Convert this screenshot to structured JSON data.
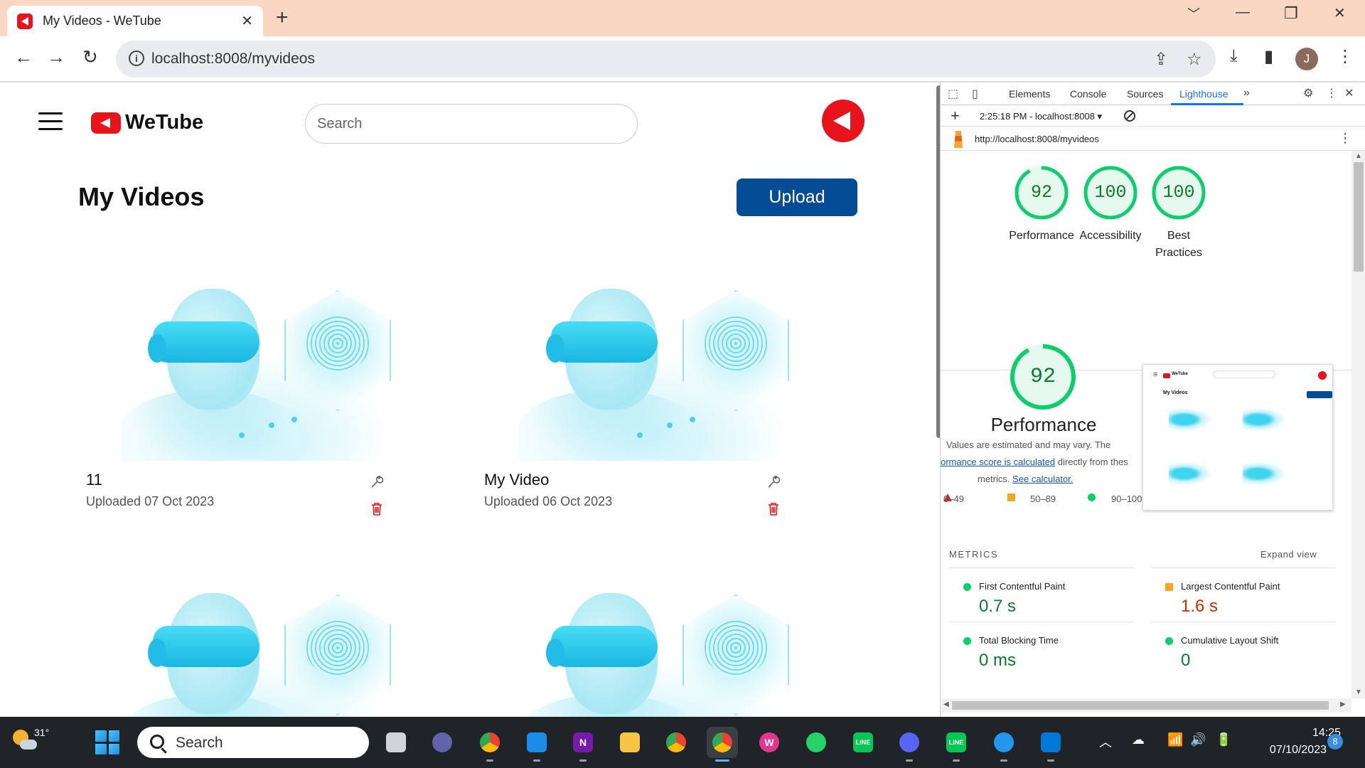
{
  "browser": {
    "tab_title": "My Videos - WeTube",
    "url": "localhost:8008/myvideos",
    "profile_initial": "J"
  },
  "app": {
    "brand": "WeTube",
    "search_placeholder": "Search",
    "page_title": "My Videos",
    "upload_label": "Upload",
    "videos": [
      {
        "title": "11",
        "date": "Uploaded 07 Oct 2023"
      },
      {
        "title": "My Video",
        "date": "Uploaded 06 Oct 2023"
      },
      {
        "title": "",
        "date": ""
      },
      {
        "title": "",
        "date": ""
      }
    ]
  },
  "devtools": {
    "tabs": [
      "Elements",
      "Console",
      "Sources",
      "Lighthouse"
    ],
    "active_tab": "Lighthouse",
    "report_selector": "2:25:18 PM - localhost:8008 ▾",
    "report_url": "http://localhost:8008/myvideos",
    "scores": [
      {
        "label": "Performance",
        "value": 92
      },
      {
        "label": "Accessibility",
        "value": 100
      },
      {
        "label": "Best Practices",
        "value": 100
      }
    ],
    "performance": {
      "score": 92,
      "title": "Performance",
      "desc_line1": "Values are estimated and may vary. The",
      "desc_link": "ormance score is calculated",
      "desc_line2": " directly from thes",
      "desc_line3": "metrics. ",
      "calc_link": "See calculator."
    },
    "legend": [
      "0–49",
      "50–89",
      "90–100"
    ],
    "screenshot": {
      "brand": "WeTube",
      "title": "My Videos"
    },
    "metrics_heading": "METRICS",
    "expand_label": "Expand view",
    "metrics": [
      {
        "name": "First Contentful Paint",
        "value": "0.7 s",
        "status": "pass"
      },
      {
        "name": "Largest Contentful Paint",
        "value": "1.6 s",
        "status": "average"
      },
      {
        "name": "Total Blocking Time",
        "value": "0 ms",
        "status": "pass"
      },
      {
        "name": "Cumulative Layout Shift",
        "value": "0",
        "status": "pass"
      }
    ]
  },
  "taskbar": {
    "temperature": "31°",
    "search_label": "Search",
    "time": "14:25",
    "date": "07/10/2023",
    "notifications": "8"
  },
  "colors": {
    "brand_red": "#e8141b",
    "upload_blue": "#054c96",
    "score_green": "#0cce6b",
    "score_text_green": "#0c7a2b",
    "average_orange": "#f5a623",
    "fail_red": "#d93025",
    "link_blue": "#1a73e8"
  }
}
